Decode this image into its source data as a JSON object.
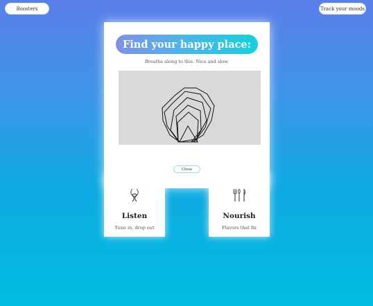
{
  "nav": {
    "boosters_label": "Boosters",
    "track_label": "Track your moods"
  },
  "modal": {
    "heading": "Find your happy place:",
    "subtitle": "Breathe along to this. Nice and slow.",
    "close_label": "Close",
    "animation_icon": "breathing-polygons-icon"
  },
  "cards": [
    {
      "icon": "knot-icon",
      "title": "Listen",
      "subtitle": "Tune in, drop out"
    },
    {
      "icon": "utensils-icon",
      "title": "Nourish",
      "subtitle": "Flavors that fix"
    }
  ],
  "colors": {
    "background_top": "#5b7fe9",
    "background_bottom": "#00bde0",
    "heading_gradient_start": "#7f90e6",
    "heading_gradient_end": "#12d2dc",
    "animation_background": "#d9d9d9"
  }
}
